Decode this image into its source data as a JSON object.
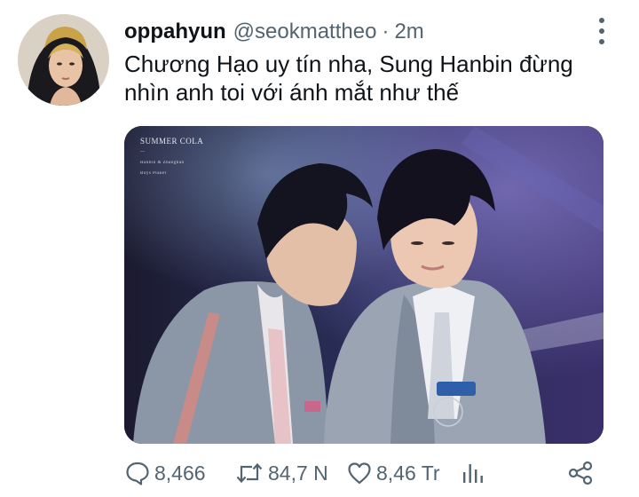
{
  "tweet": {
    "display_name": "oppahyun",
    "handle": "@seokmattheo",
    "separator": "·",
    "time": "2m",
    "text_lines": [
      "Chương Hạo uy tín nha, Sung Hanbin đừng",
      "nhìn anh toi với ánh mắt như thế"
    ],
    "media": {
      "caption_title": "SUMMER COLA",
      "caption_line1": "—",
      "caption_line2": "Hanbin & Zhanghao",
      "caption_line3": "Boys Planet"
    },
    "actions": {
      "replies": "8,466",
      "retweets": "84,7 N",
      "likes": "8,46 Tr"
    }
  },
  "icons": {
    "reply": "speech-bubble-icon",
    "retweet": "retweet-icon",
    "like": "heart-icon",
    "views": "analytics-icon",
    "share": "share-icon",
    "more": "more-vertical-icon"
  },
  "colors": {
    "text_primary": "#0f1419",
    "text_secondary": "#536471",
    "background": "#ffffff"
  }
}
